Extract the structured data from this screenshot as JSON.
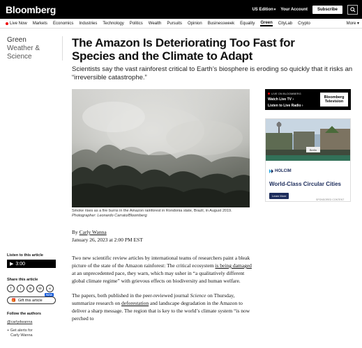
{
  "header": {
    "logo": "Bloomberg",
    "edition": "US Edition",
    "account": "Your Account",
    "subscribe": "Subscribe"
  },
  "nav": {
    "live": "Live Now",
    "items": [
      "Markets",
      "Economics",
      "Industries",
      "Technology",
      "Politics",
      "Wealth",
      "Pursuits",
      "Opinion",
      "Businessweek",
      "Equality",
      "Green",
      "CityLab",
      "Crypto"
    ],
    "active": "Green",
    "more": "More"
  },
  "section": {
    "line1": "Green",
    "line2": "Weather &",
    "line3": "Science"
  },
  "article": {
    "headline": "The Amazon Is Deteriorating Too Fast for Species and the Climate to Adapt",
    "dek": "Scientists say the vast rainforest critical to Earth’s biosphere is eroding so quickly that it risks an “irreversible catastrophe.”",
    "caption": "Smoke rises as a fire burns in the Amazon rainforest in Rondonia state, Brazil, in August 2019.",
    "credit": "Photographer: Leonardo Carrato/Bloomberg",
    "byline_prefix": "By",
    "author": "Carly Wanna",
    "date": "January 26, 2023 at 2:00 PM EST",
    "p1_a": "Two new scientific review articles by international teams of researchers paint a bleak picture of the state of the Amazon rainforest: The critical ecosystem ",
    "p1_link": "is being damaged",
    "p1_b": " at an unprecedented pace, they warn, which may usher in “a qualitatively different global climate regime” with grievous effects on biodiversity and human welfare.",
    "p2_a": "The papers, both published in the peer-reviewed journal ",
    "p2_journal": "Science",
    "p2_b": " on Thursday, summarize research on ",
    "p2_link": "deforestation",
    "p2_c": " and landscape degradation in the Amazon to deliver a sharp message. The region that is key to the world’s climate system “is now perched to"
  },
  "sidebar": {
    "listen_label": "Listen to this article",
    "listen_time": "3:00",
    "share_label": "Share this article",
    "share_icons": [
      "facebook-icon",
      "twitter-icon",
      "linkedin-icon",
      "email-icon",
      "link-icon"
    ],
    "gift_label": "Gift this article",
    "new_badge": "New",
    "follow_label": "Follow the authors",
    "follow_handle": "@carlydwanna",
    "alert_line1": "+ Get alerts for",
    "alert_line2": "Carly Wanna"
  },
  "rail": {
    "live_title": "LIVE ON BLOOMBERG",
    "watch_tv": "Watch Live TV",
    "listen_radio": "Listen to Live Radio",
    "tv_logo": "Bloomberg Television",
    "ad_brand": "HOLCIM",
    "ad_headline": "World-Class Circular Cities",
    "ad_button": "Learn More",
    "ad_sign": "Berlin",
    "sponsored": "SPONSORED CONTENT"
  }
}
